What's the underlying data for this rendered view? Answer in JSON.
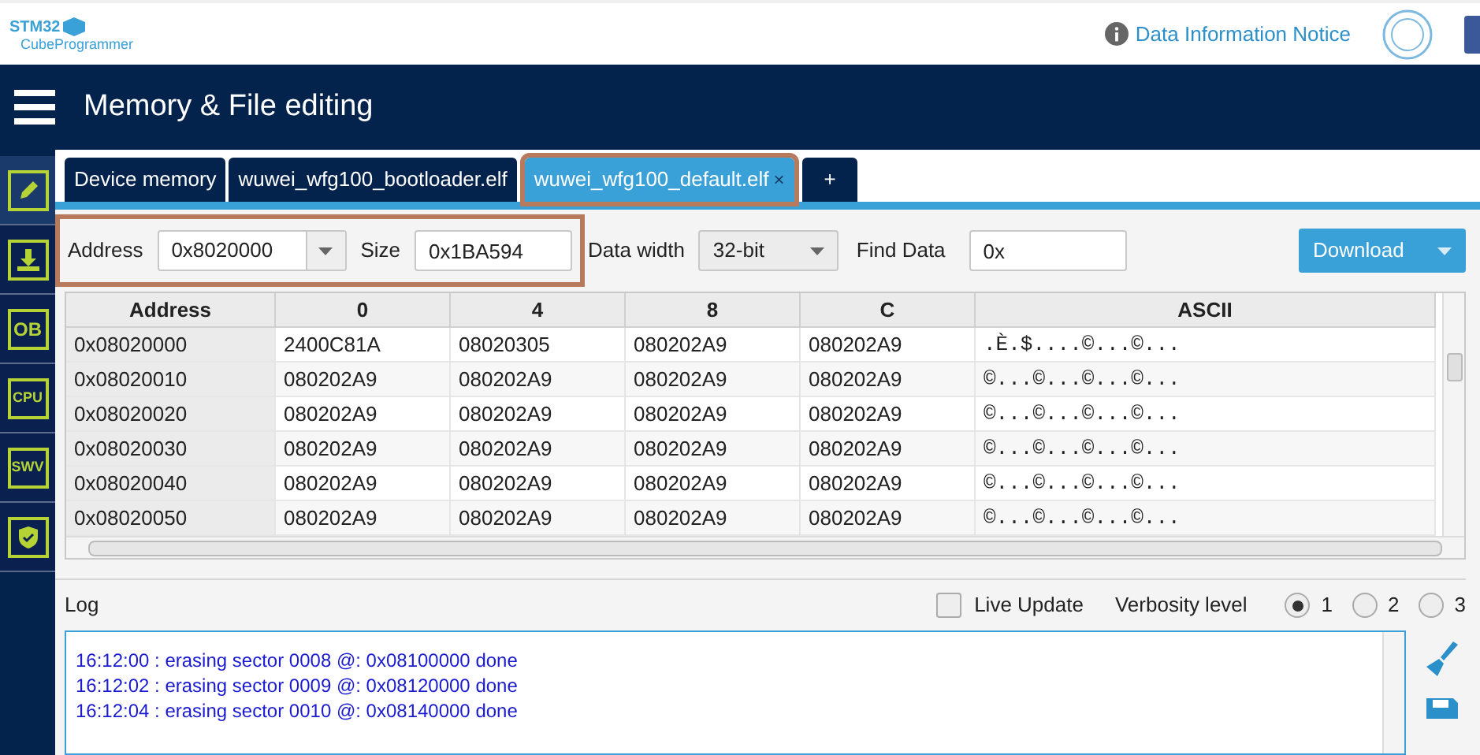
{
  "header": {
    "logo": {
      "top": "STM32",
      "bottom": "CubeProgrammer"
    },
    "notice_link": "Data Information Notice"
  },
  "title_bar": {
    "title": "Memory & File editing"
  },
  "sidebar": {
    "items": [
      {
        "kind": "pencil",
        "selected": true
      },
      {
        "kind": "download",
        "selected": false
      },
      {
        "kind": "text",
        "label": "OB",
        "selected": false
      },
      {
        "kind": "text",
        "label": "CPU",
        "selected": false
      },
      {
        "kind": "text",
        "label": "SWV",
        "selected": false
      },
      {
        "kind": "shield",
        "selected": false
      }
    ]
  },
  "tabs": [
    {
      "label": "Device memory",
      "selected": false
    },
    {
      "label": "wuwei_wfg100_bootloader.elf",
      "selected": false
    },
    {
      "label": "wuwei_wfg100_default.elf",
      "selected": true,
      "close": "×"
    },
    {
      "label": "+",
      "selected": false
    }
  ],
  "toolbar": {
    "address_label": "Address",
    "address_value": "0x8020000",
    "size_label": "Size",
    "size_value": "0x1BA594",
    "data_width_label": "Data width",
    "data_width_value": "32-bit",
    "find_label": "Find Data",
    "find_value": "0x",
    "download_button": "Download"
  },
  "table": {
    "columns": [
      "Address",
      "0",
      "4",
      "8",
      "C",
      "ASCII"
    ],
    "rows": [
      [
        "0x08020000",
        "2400C81A",
        "08020305",
        "080202A9",
        "080202A9",
        ".È.$....©...©..."
      ],
      [
        "0x08020010",
        "080202A9",
        "080202A9",
        "080202A9",
        "080202A9",
        "©...©...©...©..."
      ],
      [
        "0x08020020",
        "080202A9",
        "080202A9",
        "080202A9",
        "080202A9",
        "©...©...©...©..."
      ],
      [
        "0x08020030",
        "080202A9",
        "080202A9",
        "080202A9",
        "080202A9",
        "©...©...©...©..."
      ],
      [
        "0x08020040",
        "080202A9",
        "080202A9",
        "080202A9",
        "080202A9",
        "©...©...©...©..."
      ],
      [
        "0x08020050",
        "080202A9",
        "080202A9",
        "080202A9",
        "080202A9",
        "©...©...©...©..."
      ]
    ]
  },
  "log": {
    "label": "Log",
    "live_update": {
      "label": "Live Update",
      "checked": false
    },
    "verbosity_label": "Verbosity level",
    "verbosity": [
      {
        "label": "1",
        "selected": true
      },
      {
        "label": "2",
        "selected": false
      },
      {
        "label": "3",
        "selected": false
      }
    ],
    "lines": [
      "16:12:00 : erasing sector 0008 @: 0x08100000 done",
      "16:12:02 : erasing sector 0009 @: 0x08120000 done",
      "16:12:04 : erasing sector 0010 @: 0x08140000 done"
    ]
  }
}
